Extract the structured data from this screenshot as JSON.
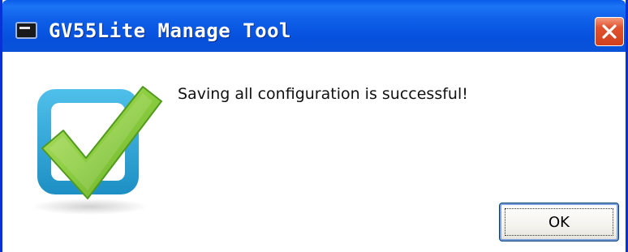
{
  "window": {
    "title": "GV55Lite Manage Tool",
    "app_icon": "console-window-icon",
    "close_icon": "close-x-icon"
  },
  "dialog": {
    "icon": "success-checkmark-icon",
    "message": "Saving all configuration is successful!",
    "ok_label": "OK"
  },
  "colors": {
    "titlebar": "#0a5ce9",
    "close_button": "#e0532f",
    "icon_frame": "#2aa6d8",
    "checkmark": "#8ccd3f"
  }
}
